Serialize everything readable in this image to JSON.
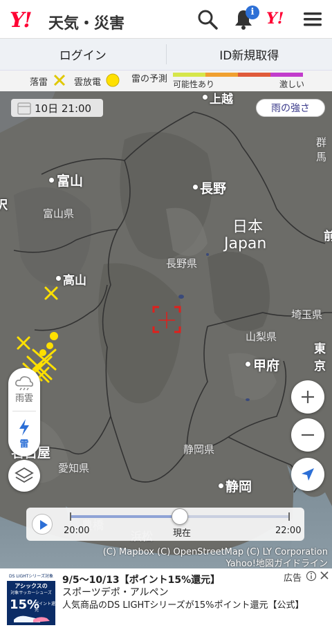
{
  "header": {
    "logo": "Y!",
    "title": "天気・災害",
    "notification_badge": "i",
    "yahoo_small_logo": "Y!",
    "icons": [
      "search-icon",
      "bell-icon",
      "menu-icon"
    ]
  },
  "account": {
    "login": "ログイン",
    "register": "ID新規取得"
  },
  "legend": {
    "strike": "落雷",
    "cloud_discharge": "雲放電",
    "forecast": "雷の予測",
    "scale_low": "可能性あり",
    "scale_high": "激しい",
    "scale_colors": [
      "#d6e64a",
      "#f0a030",
      "#e05a3a",
      "#c23ccc"
    ]
  },
  "map": {
    "time": "10日 21:00",
    "rain_button": "雨の強さ",
    "cities": [
      "上越",
      "富山",
      "長野",
      "高山",
      "甲府",
      "名古屋",
      "静岡",
      "東京",
      "浜松",
      "豊橋"
    ],
    "prefectures": [
      "富山県",
      "長野県",
      "埼玉県",
      "山梨県",
      "静岡県",
      "愛知県",
      "群馬",
      "前"
    ],
    "country": [
      "日本",
      "Japan"
    ],
    "edge_labels": [
      "沢"
    ],
    "side_tabs": {
      "rain": "雨雲",
      "thunder": "雷"
    },
    "colors": {
      "lightning": "#ffe000",
      "land": "#6b6b66",
      "target": "#e0201c",
      "tab_active": "#2c6fd6"
    }
  },
  "timeline": {
    "start": "20:00",
    "current": "現在",
    "end": "22:00",
    "position": 0.5
  },
  "attribution": [
    "(C) Mapbox (C) OpenStreetMap (C) LY Corporation",
    "Yahoo!地図ガイドライン"
  ],
  "ad": {
    "label": "広告",
    "title": "9/5〜10/13【ポイント15%還元】",
    "advertiser": "スポーツデポ・アルペン",
    "description": "人気商品のDS LIGHTシリーズが15%ポイント還元【公式】",
    "image_lines": [
      "DS LIGHTシリーズ対象",
      "アシックスの",
      "対象サッカーシューズ",
      "15%",
      "ポイント還元"
    ]
  }
}
